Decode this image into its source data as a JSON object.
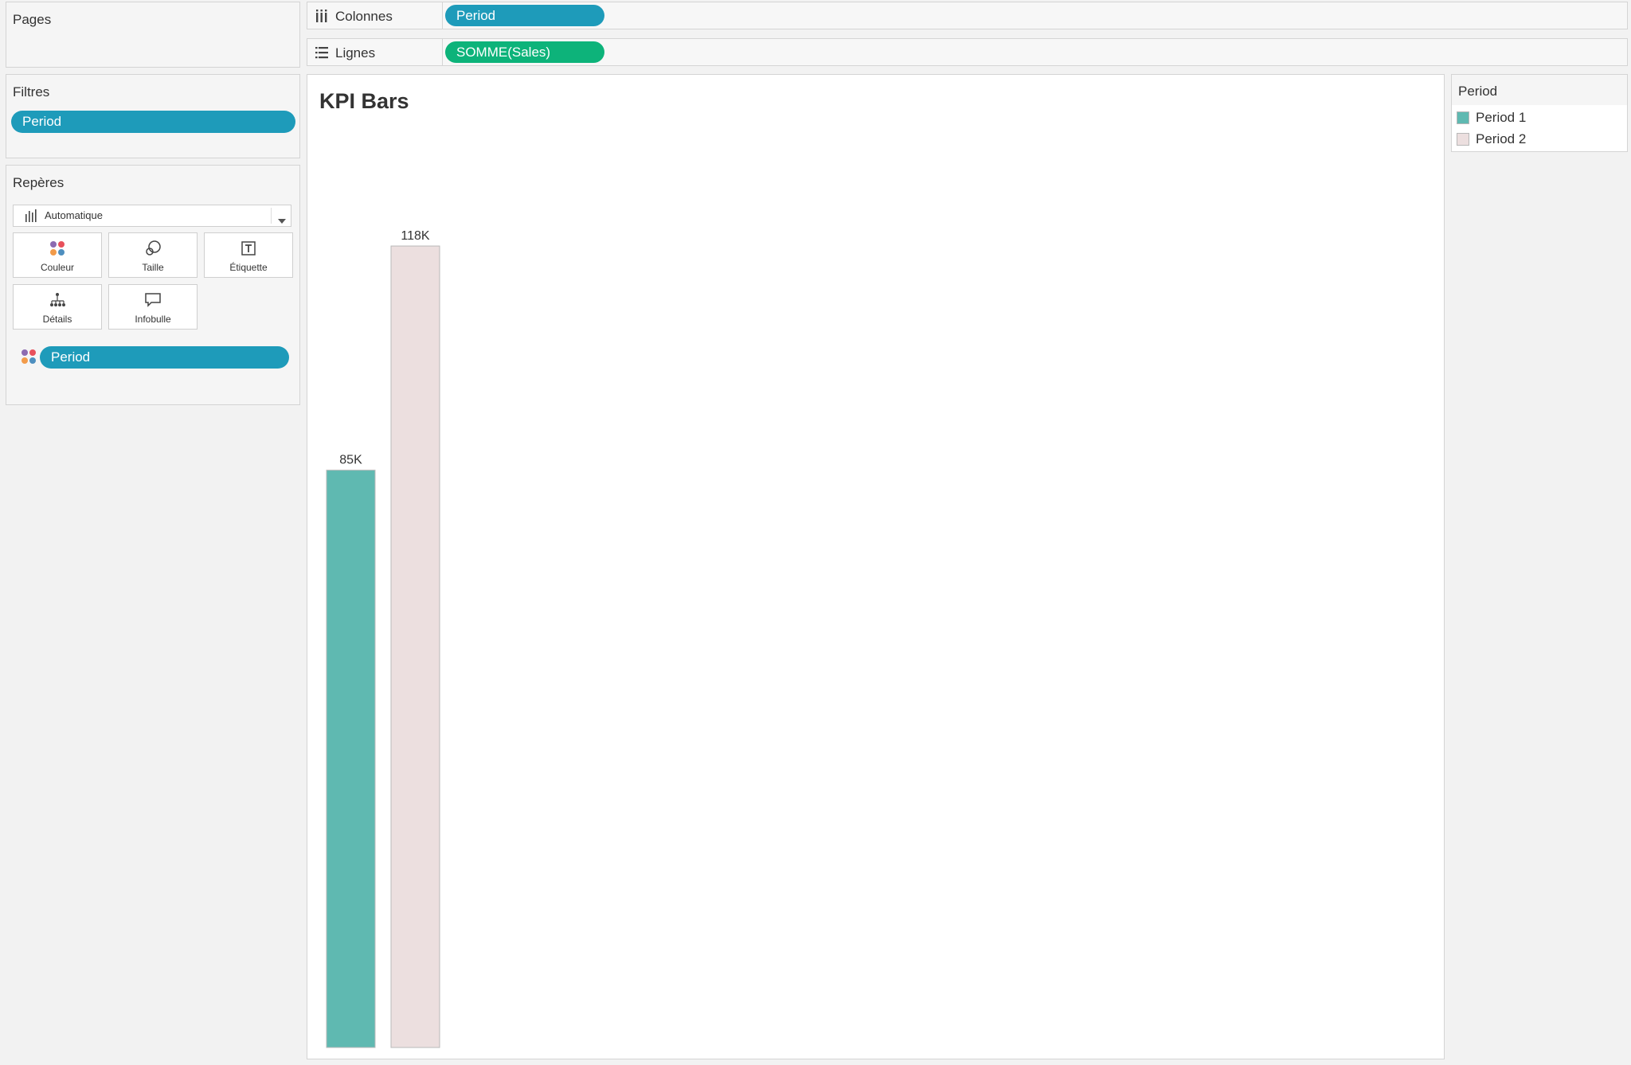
{
  "left": {
    "pages": {
      "title": "Pages"
    },
    "filters": {
      "title": "Filtres",
      "pill": "Period"
    },
    "marks": {
      "title": "Repères",
      "mark_type": "Automatique",
      "buttons": {
        "color": "Couleur",
        "size": "Taille",
        "label": "Étiquette",
        "detail": "Détails",
        "tooltip": "Infobulle"
      },
      "color_pill": "Period"
    }
  },
  "shelves": {
    "columns": {
      "label": "Colonnes",
      "pill": "Period"
    },
    "rows": {
      "label": "Lignes",
      "pill": "SOMME(Sales)"
    }
  },
  "legend": {
    "title": "Period",
    "items": [
      {
        "label": "Period 1",
        "color": "#5fb9b1"
      },
      {
        "label": "Period 2",
        "color": "#ecdfdf"
      }
    ]
  },
  "chart_data": {
    "type": "bar",
    "title": "KPI Bars",
    "categories": [
      "Period 1",
      "Period 2"
    ],
    "values": [
      85000,
      118000
    ],
    "data_labels": [
      "85K",
      "118K"
    ],
    "colors": [
      "#5fb9b1",
      "#ecdfdf"
    ],
    "ylim": [
      0,
      135000
    ],
    "grid": false
  }
}
